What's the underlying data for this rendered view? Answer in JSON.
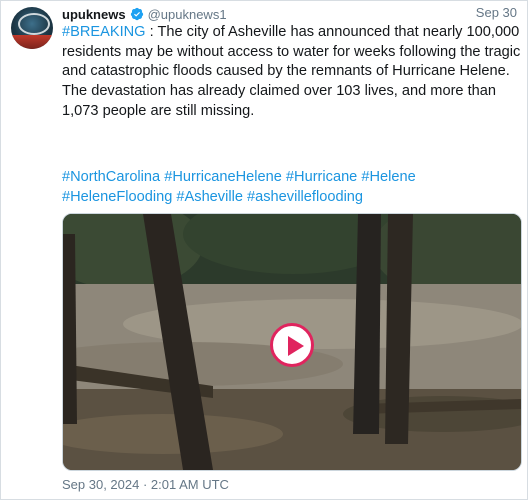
{
  "account": {
    "name": "upuknews",
    "handle": "@upuknews1",
    "date": "Sep 30"
  },
  "tweet": {
    "breaking_tag": "#BREAKING",
    "body": " : The city of Asheville has announced that nearly 100,000 residents may be without access to water for weeks following the tragic and catastrophic floods caused by the remnants of Hurricane Helene. The devastation has already claimed over 103 lives, and more than 1,073 people are still missing.",
    "hashtags": [
      "#NorthCarolina",
      "#HurricaneHelene",
      "#Hurricane",
      "#Helene",
      "#HeleneFlooding",
      "#Asheville",
      "#ashevilleflooding"
    ]
  },
  "media": {
    "type": "video",
    "play_icon": "play-button-icon",
    "accent_color": "#e0245e"
  },
  "timestamp": "Sep 30, 2024 · 2:01 AM UTC",
  "colors": {
    "link": "#1b95e0",
    "text": "#14171a",
    "muted": "#657786",
    "verified": "#1da1f2"
  }
}
